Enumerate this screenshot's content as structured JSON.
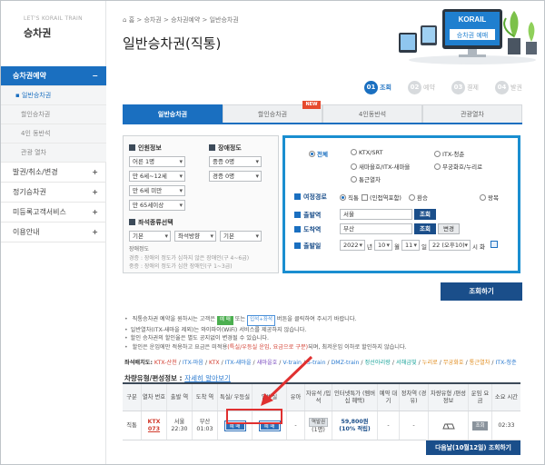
{
  "sidebar": {
    "brand_small": "LET'S KORAIL TRAIN",
    "title": "승차권",
    "menu": [
      {
        "label": "승차권예약",
        "active": true
      },
      {
        "label": "발권/취소/변경"
      },
      {
        "label": "정기승차권"
      },
      {
        "label": "미등록고객서비스"
      },
      {
        "label": "이용안내"
      }
    ],
    "submenu": [
      "일반승차권",
      "할인승차권",
      "4인 동반석",
      "관광 열차"
    ]
  },
  "header": {
    "breadcrumb": "홈 > 승차권 > 승차권예약 > 일반승차권",
    "title": "일반승차권(직통)",
    "illus_label": "승차권 예매",
    "illus_brand": "KORAIL"
  },
  "steps": [
    {
      "num": "01",
      "label": "조회",
      "active": true
    },
    {
      "num": "02",
      "label": "예약"
    },
    {
      "num": "03",
      "label": "결제"
    },
    {
      "num": "04",
      "label": "발권"
    }
  ],
  "tabs": [
    {
      "label": "일반승차권",
      "active": true
    },
    {
      "label": "할인승차권"
    },
    {
      "label": "4인동반석"
    },
    {
      "label": "관광열차"
    }
  ],
  "tab_badge": "NEW",
  "options": {
    "passenger_label": "인원정보",
    "disability_label": "장애정도",
    "passenger_selects": [
      "어른 1명",
      "만 6세~12세",
      "만 6세 미만",
      "만 65세이상"
    ],
    "disability_selects": [
      "중증 0명",
      "경증 0명"
    ],
    "seat_type_label": "좌석종류선택",
    "seat_selects": [
      "기본",
      "좌석방향",
      "기본"
    ],
    "disability_note_title": "장애정도",
    "disability_note_1": "경증 : 장애의 정도가 심하지 않은 장애인(구 4~6급)",
    "disability_note_2": "중증 : 장애의 정도가 심한 장애인(구 1~3급)"
  },
  "search": {
    "train_types": [
      {
        "label": "전체",
        "checked": true
      },
      {
        "label": "KTX/SRT"
      },
      {
        "label": "ITX-청춘"
      },
      {
        "label": "새마을호/ITX-새마을"
      },
      {
        "label": "무궁화호/누리로"
      },
      {
        "label": "통근열차"
      }
    ],
    "trip_type_label": "여정경로",
    "trip_types": [
      {
        "label": "직통",
        "checked": true
      },
      {
        "label": "(인접역포함)"
      },
      {
        "label": "환승"
      },
      {
        "label": "왕복"
      }
    ],
    "departure_label": "출발역",
    "departure_value": "서울",
    "arrival_label": "도착역",
    "arrival_value": "부산",
    "lookup_label": "조회",
    "swap_label": "변경",
    "date_label": "출발일",
    "date_year": "2022",
    "date_year_unit": "년",
    "date_month": "10",
    "date_month_unit": "월",
    "date_day": "11",
    "date_day_unit": "일",
    "date_hour": "22 (오후10)",
    "date_hour_unit": "시",
    "weekday": "화"
  },
  "query_button": "조회하기",
  "notes": {
    "line1_a": "직통승차권 예약을 원하시는 고객은",
    "line1_tag1": "예 매",
    "line1_b": "또는",
    "line1_tag2": "입석+좌석",
    "line1_c": "버튼을 클릭하여 주시기 바랍니다.",
    "line2": "일반열차(ITX-새마을 제외)는 와이파이(WiFi) 서비스를 제공하지 않습니다.",
    "line3": "할인 승차권의 할인율은 별도 공지없이 변경될 수 있습니다.",
    "line4_a": "할인은 운임에만 적용하고 요금은 미적용",
    "line4_b": "(특실/우등실 운임, 요금으로 구분)",
    "line4_c": "되며, 최저운임 이하로 할인하지 않습니다."
  },
  "legend": {
    "prefix": "좌석배치도:",
    "items": [
      "KTX-산천",
      "ITX-마음",
      "KTX",
      "ITX-새마을",
      "새마을호",
      "V-train",
      "S-train",
      "DMZ-train",
      "정선아리랑",
      "서해금빛",
      "누리로",
      "무궁화호",
      "통근열차",
      "ITX-청춘"
    ]
  },
  "seat_info": {
    "title": "차량유형/편성정보 :",
    "link": "자세히 알아보기"
  },
  "table": {
    "headers": [
      "구분",
      "열차 번호",
      "출발 역",
      "도착 역",
      "특실/ 우등실",
      "일반실",
      "유아",
      "자유석 /입석",
      "인터넷특가 (멤버십 혜택)",
      "예약 대기",
      "정차역 (경유)",
      "차량유형 /편성정보",
      "운임 요금",
      "소요 시간"
    ],
    "row": {
      "type": "직통",
      "train_kind": "KTX",
      "train_no": "073",
      "dep_station": "서울",
      "dep_time": "22:30",
      "arr_station": "부산",
      "arr_time": "01:03",
      "first_class_btn": "예 매",
      "standard_btn": "예 매",
      "infant": "-",
      "standing_btn": "역발권",
      "standing_note": "(1명)",
      "price": "59,800원",
      "price_note": "(10% 적립)",
      "waitlist": "-",
      "stops": "-",
      "fare_btn": "조회",
      "duration": "02:33"
    }
  },
  "next_button": "다음날(10월12일) 조회하기"
}
